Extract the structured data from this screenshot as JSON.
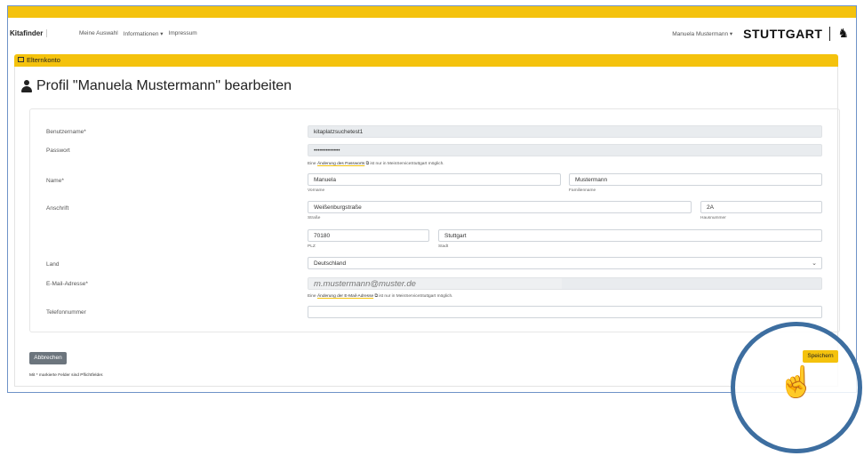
{
  "nav": {
    "brand": "Kitafinder",
    "links": [
      "Meine Auswahl",
      "Informationen ▾",
      "Impressum"
    ],
    "user_menu": "Manuela Mustermann ▾",
    "logo": "STUTTGART"
  },
  "card": {
    "header": "Elternkonto"
  },
  "page": {
    "title": "Profil \"Manuela Mustermann\" bearbeiten"
  },
  "form": {
    "username": {
      "label": "Benutzername*",
      "value": "kitaplatzsuchetest1"
    },
    "password": {
      "label": "Passwort",
      "value": "•••••••••••••",
      "hint_prefix": "Eine",
      "hint_link": "Änderung des Passworts",
      "hint_suffix": "ist nur in MeinServiceStuttgart möglich."
    },
    "name": {
      "label": "Name*",
      "first": "Manuela",
      "first_sub": "Vorname",
      "last": "Mustermann",
      "last_sub": "Familienname"
    },
    "address": {
      "label": "Anschrift",
      "street": "Weißenburgstraße",
      "street_sub": "Straße",
      "number": "2A",
      "number_sub": "Hausnummer",
      "zip": "70180",
      "zip_sub": "PLZ",
      "city": "Stuttgart",
      "city_sub": "Stadt"
    },
    "country": {
      "label": "Land",
      "value": "Deutschland"
    },
    "email": {
      "label": "E-Mail-Adresse*",
      "value": "m.mustermann@muster.de",
      "hint_prefix": "Eine",
      "hint_link": "Änderung der E-Mail-Adresse",
      "hint_suffix": "ist nur in MeinServiceStuttgart möglich."
    },
    "phone": {
      "label": "Telefonnummer",
      "value": ""
    }
  },
  "actions": {
    "cancel": "Abbrechen",
    "save": "Speichern"
  },
  "footnote": "Mit * markierte Felder sind Pflichtfelder.",
  "colors": {
    "accent": "#f4c20d",
    "overlay_ring": "#3d6ea0",
    "cancel_button": "#6c757d"
  },
  "icons": {
    "overlay": "pointing-hand-click-icon"
  }
}
